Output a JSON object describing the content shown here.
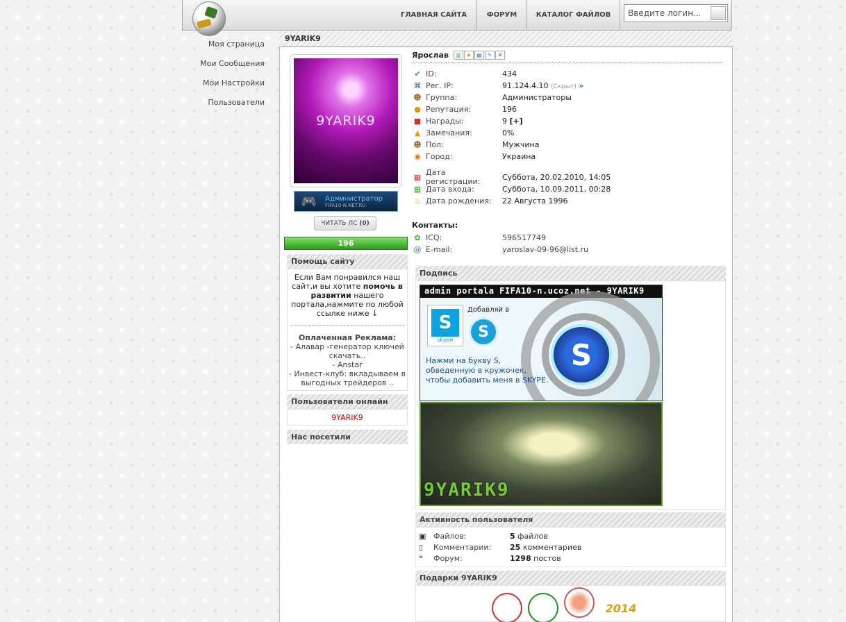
{
  "header": {
    "nav": [
      "ГЛАВНАЯ САЙТА",
      "ФОРУМ",
      "КАТАЛОГ ФАЙЛОВ"
    ],
    "login_placeholder": "Введите логин..."
  },
  "left_menu": [
    "Моя страница",
    "Мои Сообщения",
    "Мои Настройки",
    "Пользователи"
  ],
  "page_title": "9YARIK9",
  "profile": {
    "avatar_text": "9YARIK9",
    "rank_label": "Администратор",
    "rank_site": "FIFA10-N.NET.RU",
    "read_pm_label": "ЧИТАТЬ ЛС",
    "read_pm_count": "(0)",
    "reputation": "196",
    "name": "Ярослав",
    "fields": [
      {
        "icon": "check-icon",
        "glyph": "✔",
        "color": "#3a3",
        "label": "ID:",
        "value": "434"
      },
      {
        "icon": "network-icon",
        "glyph": "⌘",
        "color": "#36a",
        "label": "Рег. IP:",
        "value": "91.124.4.10",
        "note": "(Скрыт)"
      },
      {
        "icon": "group-icon",
        "glyph": "☻",
        "color": "#a63",
        "label": "Группа:",
        "value": "Администраторы"
      },
      {
        "icon": "medal-icon",
        "glyph": "●",
        "color": "#d90",
        "label": "Репутация:",
        "value": "196"
      },
      {
        "icon": "gift-icon",
        "glyph": "■",
        "color": "#c33",
        "label": "Награды:",
        "value": "9",
        "extra": "[+]"
      },
      {
        "icon": "warning-icon",
        "glyph": "▲",
        "color": "#e90",
        "label": "Замечания:",
        "value": "0%"
      },
      {
        "icon": "gender-icon",
        "glyph": "☻",
        "color": "#a63",
        "label": "Пол:",
        "value": "Мужчина"
      },
      {
        "icon": "city-icon",
        "glyph": "◉",
        "color": "#d70",
        "label": "Город:",
        "value": "Украина"
      }
    ],
    "dates": [
      {
        "icon": "calendar-reg-icon",
        "label": "Дата регистрации:",
        "value": "Суббота, 20.02.2010, 14:05"
      },
      {
        "icon": "calendar-login-icon",
        "label": "Дата входа:",
        "value": "Суббота, 10.09.2011, 00:28"
      },
      {
        "icon": "cake-icon",
        "label": "Дата рождения:",
        "value": "22 Августа 1996"
      }
    ],
    "contacts_title": "Контакты:",
    "contacts": [
      {
        "icon": "icq-icon",
        "label": "ICQ:",
        "value": "596517749"
      },
      {
        "icon": "email-icon",
        "label": "E-mail:",
        "value": "yaroslav-09-96@list.ru"
      }
    ]
  },
  "sidebar": {
    "help_title": "Помощь сайту",
    "help_text_1": "Если Вам понравился наш сайт,и вы хотите",
    "help_text_bold": "помочь в развитии",
    "help_text_2": "нашего портала,нажмите по любой ссылке ниже ↓",
    "ads_title": "Оплаченная Реклама:",
    "ads": [
      "- Алавар -генератор ключей скачать..",
      "- Anstar",
      "- Инвест-клуб: вкладываем в выгодных трейдеров .."
    ],
    "online_title": "Пользователи онлайн",
    "online_user": "9YARIK9",
    "visited_title": "Нас посетили"
  },
  "signature": {
    "title": "Подпись",
    "banner_top": "admin portala FIFA10-n.ucoz.net - 9YARIK9",
    "skype_logo": "S",
    "skype_word": "skype",
    "add_text": "Добавляй в",
    "instruction": "Нажми на букву S, обведенную в кружочек, чтобы добавить меня в SKYPE.",
    "banner2_text": "9YARIK9"
  },
  "activity": {
    "title": "Активность пользователя",
    "rows": [
      {
        "icon": "files-icon",
        "label": "Файлов:",
        "count": "5",
        "unit": "файлов"
      },
      {
        "icon": "comments-icon",
        "label": "Комментарии:",
        "count": "25",
        "unit": "комментариев"
      },
      {
        "icon": "forum-icon",
        "label": "Форум:",
        "count": "1298",
        "unit": "постов"
      }
    ]
  },
  "gifts": {
    "title": "Подарки 9YARIK9"
  },
  "colors": {
    "accent_green": "#2d9a1d",
    "link_red": "#c00",
    "skype_blue": "#0aa3e0"
  }
}
